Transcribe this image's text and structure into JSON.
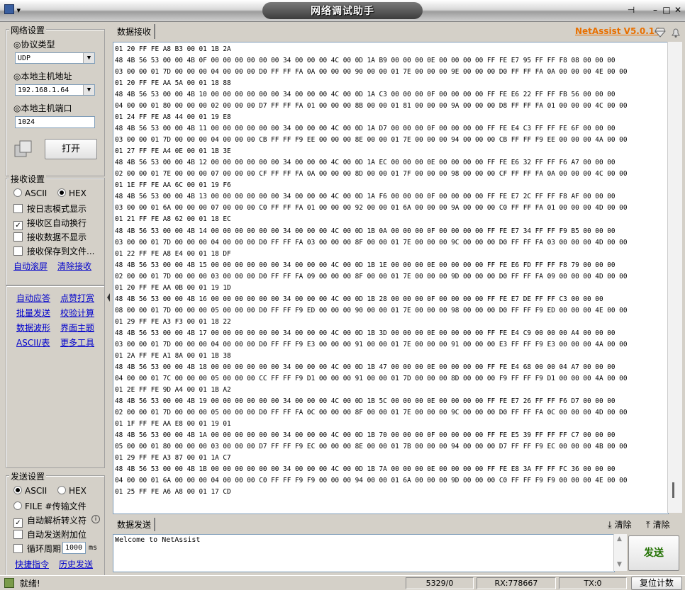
{
  "window": {
    "title": "网络调试助手",
    "sysmenu_glyph": "▾",
    "pin_glyph": "⊣",
    "minimize_glyph": "–",
    "maximize_glyph": "□",
    "close_glyph": "✕"
  },
  "network": {
    "legend": "网络设置",
    "protocol_label": "◎协议类型",
    "protocol_value": "UDP",
    "host_addr_label": "◎本地主机地址",
    "host_addr_value": "192.168.1.64",
    "host_port_label": "◎本地主机端口",
    "host_port_value": "1024",
    "open_button": "打开"
  },
  "receive_settings": {
    "legend": "接收设置",
    "ascii": "ASCII",
    "hex": "HEX",
    "selected": "HEX",
    "log_mode": "按日志模式显示",
    "auto_wrap": "接收区自动换行",
    "hide_data": "接收数据不显示",
    "save_to_file": "接收保存到文件...",
    "auto_scroll": "自动滚屏",
    "clear_recv": "清除接收"
  },
  "tools": {
    "auto_reply": "自动应答",
    "dot_hitter": "点赞打赏",
    "batch_send": "批量发送",
    "checksum": "校验计算",
    "waveform": "数据波形",
    "theme": "界面主题",
    "ascii_table": "ASCII/表",
    "more_tools": "更多工具"
  },
  "send_settings": {
    "legend": "发送设置",
    "ascii": "ASCII",
    "hex": "HEX",
    "selected": "ASCII",
    "file": "FILE #传输文件",
    "parse_escape": "自动解析转义符",
    "append_checksum": "自动发送附加位",
    "cycle": "循环周期",
    "cycle_value": "1000",
    "cycle_unit": "ms",
    "shortcuts": "快捷指令",
    "history": "历史发送"
  },
  "receive": {
    "tab_label": "数据接收",
    "brand": "NetAssist V5.0.14",
    "lines": [
      "01 20 FF FE A8 B3 00 01 1B 2A",
      "48 4B 56 53 00 00 4B 0F 00 00 00 00 00 00 34 00 00 00 4C 00 0D 1A B9 00 00 00 0E 00 00 00 00 FF FE E7 95 FF FF F8 08 00 00 00",
      "03 00 00 01 7D 00 00 00 04 00 00 00 D0 FF FF FA 0A 00 00 00 90 00 00 01 7E 00 00 00 9E 00 00 00 D0 FF FF FA 0A 00 00 00 4E 00 00",
      "01 20 FF FE AA 5A 00 01 18 88",
      "48 4B 56 53 00 00 4B 10 00 00 00 00 00 00 34 00 00 00 4C 00 0D 1A C3 00 00 00 0F 00 00 00 00 FF FE E6 22 FF FF FB 56 00 00 00",
      "04 00 00 01 80 00 00 00 02 00 00 00 D7 FF FF FA 01 00 00 00 8B 00 00 01 81 00 00 00 9A 00 00 00 D8 FF FF FA 01 00 00 00 4C 00 00",
      "01 24 FF FE A8 44 00 01 19 E8",
      "48 4B 56 53 00 00 4B 11 00 00 00 00 00 00 34 00 00 00 4C 00 0D 1A D7 00 00 00 0F 00 00 00 00 FF FE E4 C3 FF FF FE 6F 00 00 00",
      "03 00 00 01 7D 00 00 00 04 00 00 00 CB FF FF F9 EE 00 00 00 8E 00 00 01 7E 00 00 00 94 00 00 00 CB FF FF F9 EE 00 00 00 4A 00 00",
      "01 27 FF FE A4 0E 00 01 1B 3E",
      "48 4B 56 53 00 00 4B 12 00 00 00 00 00 00 34 00 00 00 4C 00 0D 1A EC 00 00 00 0E 00 00 00 00 FF FE E6 32 FF FF F6 A7 00 00 00",
      "02 00 00 01 7E 00 00 00 07 00 00 00 CF FF FF FA 0A 00 00 00 8D 00 00 01 7F 00 00 00 98 00 00 00 CF FF FF FA 0A 00 00 00 4C 00 00",
      "01 1E FF FE AA 6C 00 01 19 F6",
      "48 4B 56 53 00 00 4B 13 00 00 00 00 00 00 34 00 00 00 4C 00 0D 1A F6 00 00 00 0F 00 00 00 00 FF FE E7 2C FF FF F8 AF 00 00 00",
      "03 00 00 01 6A 00 00 00 07 00 00 00 C0 FF FF FA 01 00 00 00 92 00 00 01 6A 00 00 00 9A 00 00 00 C0 FF FF FA 01 00 00 00 4D 00 00",
      "01 21 FF FE A8 62 00 01 18 EC",
      "48 4B 56 53 00 00 4B 14 00 00 00 00 00 00 34 00 00 00 4C 00 0D 1B 0A 00 00 00 0F 00 00 00 00 FF FE E7 34 FF FF F9 B5 00 00 00",
      "03 00 00 01 7D 00 00 00 04 00 00 00 D0 FF FF FA 03 00 00 00 8F 00 00 01 7E 00 00 00 9C 00 00 00 D0 FF FF FA 03 00 00 00 4D 00 00",
      "01 22 FF FE A8 E4 00 01 18 DF",
      "48 4B 56 53 00 00 4B 15 00 00 00 00 00 00 34 00 00 00 4C 00 0D 1B 1E 00 00 00 0E 00 00 00 00 FF FE E6 FD FF FF F8 79 00 00 00",
      "02 00 00 01 7D 00 00 00 03 00 00 00 D0 FF FF FA 09 00 00 00 8F 00 00 01 7E 00 00 00 9D 00 00 00 D0 FF FF FA 09 00 00 00 4D 00 00",
      "01 20 FF FE AA 0B 00 01 19 1D",
      "48 4B 56 53 00 00 4B 16 00 00 00 00 00 00 34 00 00 00 4C 00 0D 1B 28 00 00 00 0F 00 00 00 00 FF FE E7 DE FF FF C3 00 00 00",
      "08 00 00 01 7D 00 00 00 05 00 00 00 D0 FF FF F9 ED 00 00 00 90 00 00 01 7E 00 00 00 98 00 00 00 D0 FF FF F9 ED 00 00 00 4E 00 00",
      "01 29 FF FE A3 F3 00 01 18 22",
      "48 4B 56 53 00 00 4B 17 00 00 00 00 00 00 34 00 00 00 4C 00 0D 1B 3D 00 00 00 0E 00 00 00 00 FF FE E4 C9 00 00 00 A4 00 00 00",
      "03 00 00 01 7D 00 00 00 04 00 00 00 D0 FF FF F9 E3 00 00 00 91 00 00 01 7E 00 00 00 91 00 00 00 E3 FF FF F9 E3 00 00 00 4A 00 00",
      "01 2A FF FE A1 8A 00 01 1B 38",
      "48 4B 56 53 00 00 4B 18 00 00 00 00 00 00 34 00 00 00 4C 00 0D 1B 47 00 00 00 0E 00 00 00 00 FF FE E4 68 00 00 04 A7 00 00 00",
      "04 00 00 01 7C 00 00 00 05 00 00 00 CC FF FF F9 D1 00 00 00 91 00 00 01 7D 00 00 00 8D 00 00 00 F9 FF FF F9 D1 00 00 00 4A 00 00",
      "01 2E FF FE 9D A4 00 01 1B A2",
      "48 4B 56 53 00 00 4B 19 00 00 00 00 00 00 34 00 00 00 4C 00 0D 1B 5C 00 00 00 0E 00 00 00 00 FF FE E7 26 FF FF F6 D7 00 00 00",
      "02 00 00 01 7D 00 00 00 05 00 00 00 D0 FF FF FA 0C 00 00 00 8F 00 00 01 7E 00 00 00 9C 00 00 00 D0 FF FF FA 0C 00 00 00 4D 00 00",
      "01 1F FF FE AA E8 00 01 19 01",
      "48 4B 56 53 00 00 4B 1A 00 00 00 00 00 00 34 00 00 00 4C 00 0D 1B 70 00 00 00 0F 00 00 00 00 FF FE E5 39 FF FF FF C7 00 00 00",
      "05 00 00 01 80 00 00 00 03 00 00 00 D7 FF FF F9 EC 00 00 00 8E 00 00 01 7B 00 00 00 94 00 00 00 D7 FF FF F9 EC 00 00 00 4B 00 00",
      "01 29 FF FE A3 87 00 01 1A C7",
      "48 4B 56 53 00 00 4B 1B 00 00 00 00 00 00 34 00 00 00 4C 00 0D 1B 7A 00 00 00 0E 00 00 00 00 FF FE E8 3A FF FF FC 36 00 00 00",
      "04 00 00 01 6A 00 00 00 04 00 00 00 C0 FF FF F9 F9 00 00 00 94 00 00 01 6A 00 00 00 9D 00 00 00 C0 FF FF F9 F9 00 00 00 4E 00 00",
      "01 25 FF FE A6 A8 00 01 17 CD"
    ]
  },
  "send": {
    "tab_label": "数据发送",
    "clear_label_1": "清除",
    "clear_label_2": "清除",
    "text": "Welcome to NetAssist",
    "send_button": "发送"
  },
  "status": {
    "ready": "就绪!",
    "counter": "5329/0",
    "rx": "RX:778667",
    "tx": "TX:0",
    "reset": "复位计数"
  }
}
